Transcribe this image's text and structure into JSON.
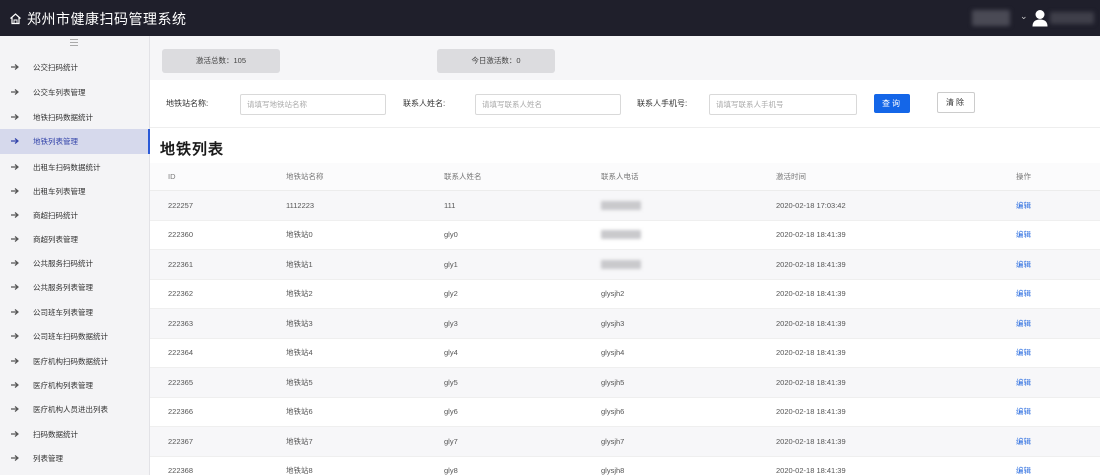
{
  "header": {
    "app_title": "郑州市健康扫码管理系统",
    "logo_icon": "home-icon",
    "user_icon": "user-icon"
  },
  "sidebar": {
    "items": [
      {
        "label": "公交扫码统计",
        "active": false
      },
      {
        "label": "公交车列表管理",
        "active": false
      },
      {
        "label": "地铁扫码数据统计",
        "active": false
      },
      {
        "label": "地铁列表管理",
        "active": true
      },
      {
        "label": "出租车扫码数据统计",
        "active": false
      },
      {
        "label": "出租车列表管理",
        "active": false
      },
      {
        "label": "商超扫码统计",
        "active": false
      },
      {
        "label": "商超列表管理",
        "active": false
      },
      {
        "label": "公共服务扫码统计",
        "active": false
      },
      {
        "label": "公共服务列表管理",
        "active": false
      },
      {
        "label": "公司班车列表管理",
        "active": false
      },
      {
        "label": "公司班车扫码数据统计",
        "active": false
      },
      {
        "label": "医疗机构扫码数据统计",
        "active": false
      },
      {
        "label": "医疗机构列表管理",
        "active": false
      },
      {
        "label": "医疗机构人员进出列表",
        "active": false
      },
      {
        "label": "扫码数据统计",
        "active": false
      },
      {
        "label": "列表管理",
        "active": false
      }
    ]
  },
  "stats": {
    "total": "激活总数：105",
    "today": "今日激活数：0"
  },
  "filter": {
    "station_label": "地铁站名称:",
    "station_placeholder": "请填写地铁站名称",
    "contact_label": "联系人姓名:",
    "contact_placeholder": "请填写联系人姓名",
    "phone_label": "联系人手机号:",
    "phone_placeholder": "请填写联系人手机号",
    "query_label": "查询",
    "clear_label": "清除"
  },
  "page_title": "地铁列表",
  "table": {
    "headers": [
      "ID",
      "地铁站名称",
      "联系人姓名",
      "联系人电话",
      "激活时间",
      "操作"
    ],
    "rows": [
      {
        "id": "222257",
        "station": "1112223",
        "contact": "111",
        "phone": "",
        "time": "2020-02-18 17:03:42",
        "action": "编辑"
      },
      {
        "id": "222360",
        "station": "地铁站0",
        "contact": "gly0",
        "phone": "",
        "time": "2020-02-18 18:41:39",
        "action": "编辑"
      },
      {
        "id": "222361",
        "station": "地铁站1",
        "contact": "gly1",
        "phone": "",
        "time": "2020-02-18 18:41:39",
        "action": "编辑"
      },
      {
        "id": "222362",
        "station": "地铁站2",
        "contact": "gly2",
        "phone": "glysjh2",
        "time": "2020-02-18 18:41:39",
        "action": "编辑"
      },
      {
        "id": "222363",
        "station": "地铁站3",
        "contact": "gly3",
        "phone": "glysjh3",
        "time": "2020-02-18 18:41:39",
        "action": "编辑"
      },
      {
        "id": "222364",
        "station": "地铁站4",
        "contact": "gly4",
        "phone": "glysjh4",
        "time": "2020-02-18 18:41:39",
        "action": "编辑"
      },
      {
        "id": "222365",
        "station": "地铁站5",
        "contact": "gly5",
        "phone": "glysjh5",
        "time": "2020-02-18 18:41:39",
        "action": "编辑"
      },
      {
        "id": "222366",
        "station": "地铁站6",
        "contact": "gly6",
        "phone": "glysjh6",
        "time": "2020-02-18 18:41:39",
        "action": "编辑"
      },
      {
        "id": "222367",
        "station": "地铁站7",
        "contact": "gly7",
        "phone": "glysjh7",
        "time": "2020-02-18 18:41:39",
        "action": "编辑"
      },
      {
        "id": "222368",
        "station": "地铁站8",
        "contact": "gly8",
        "phone": "glysjh8",
        "time": "2020-02-18 18:41:39",
        "action": "编辑"
      }
    ]
  },
  "colors": {
    "topbar": "#1f1f2b",
    "accent": "#1466e8",
    "active_item_bg": "#d6d9ec",
    "link": "#2b6de0"
  }
}
